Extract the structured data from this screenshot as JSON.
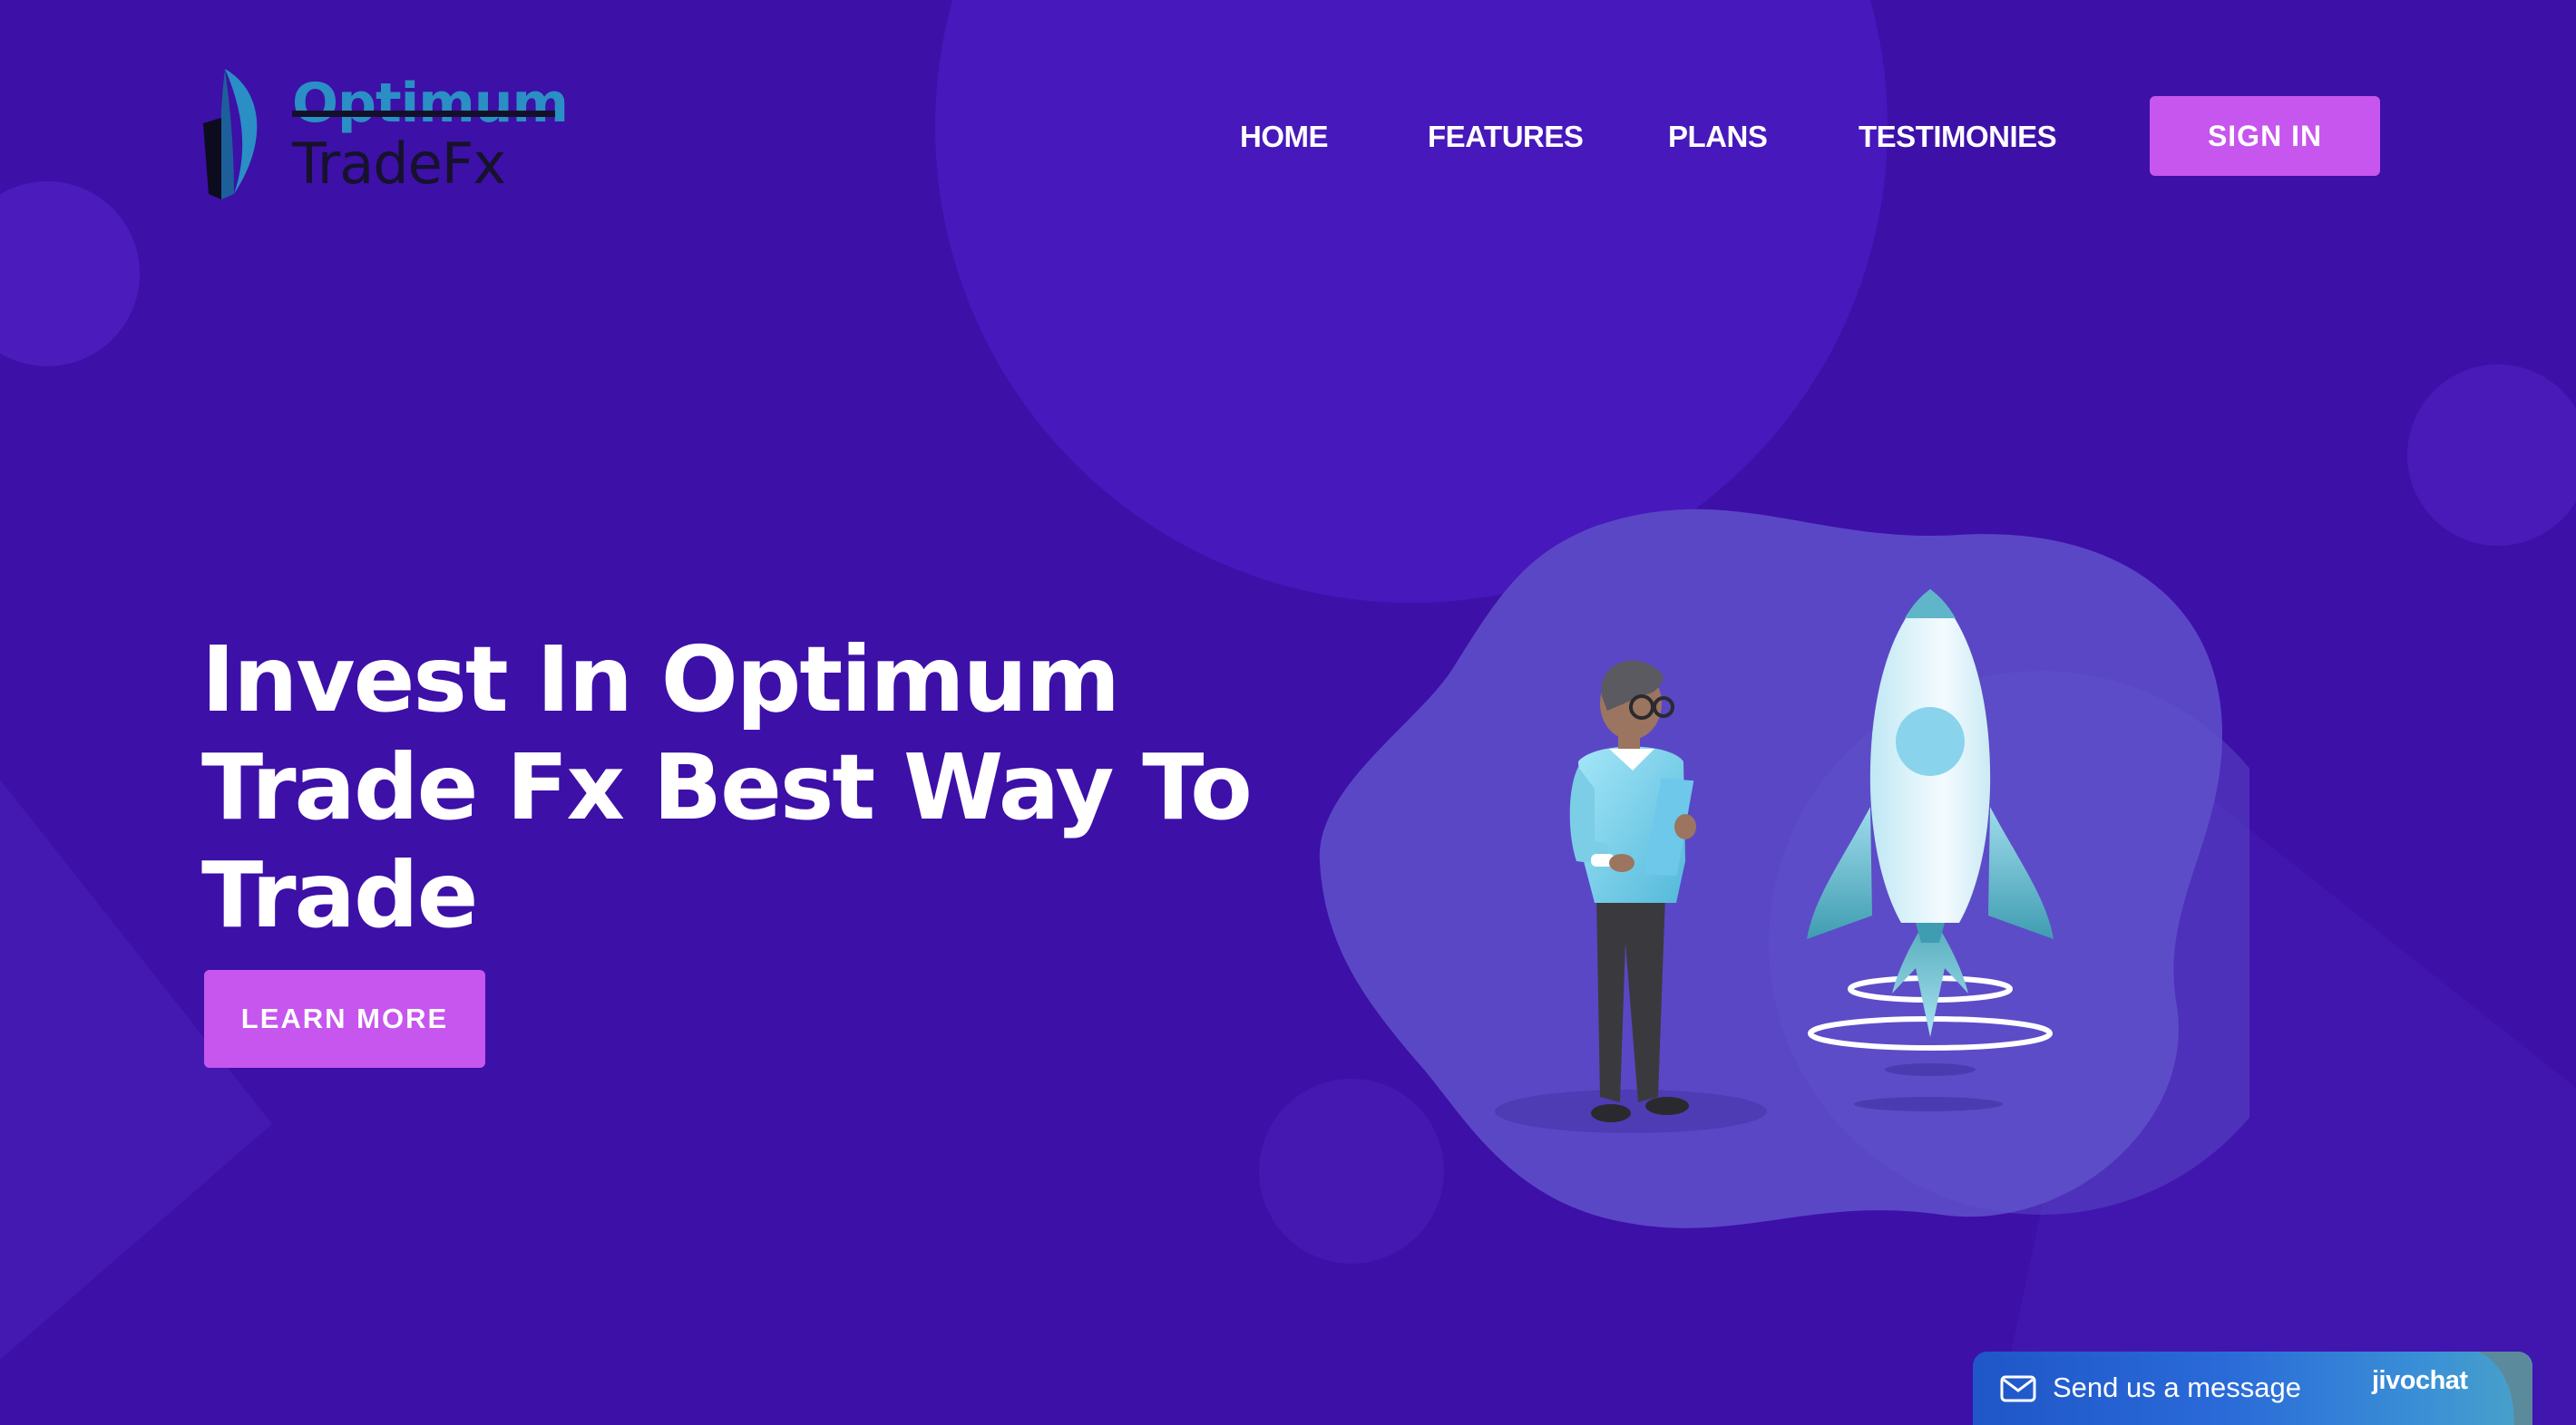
{
  "logo": {
    "line1": "Optimum",
    "line2": "TradeFx"
  },
  "nav": {
    "items": [
      {
        "label": "HOME"
      },
      {
        "label": "FEATURES"
      },
      {
        "label": "PLANS"
      },
      {
        "label": "TESTIMONIES"
      }
    ],
    "signin_label": "SIGN IN"
  },
  "hero": {
    "title_lines": [
      "Invest In Optimum",
      "Trade Fx Best Way To",
      "Trade"
    ],
    "cta_label": "LEARN MORE"
  },
  "chat_widget": {
    "message": "Send us a message",
    "brand": "jivochat"
  },
  "colors": {
    "background": "#3d10a8",
    "accent_button": "#c656ee",
    "blob": "#5a47c6",
    "logo_blue": "#2a8fc4",
    "text_white": "#ffffff"
  },
  "icons": [
    "logo-mark-icon",
    "envelope-icon",
    "rocket-illustration",
    "person-illustration"
  ]
}
